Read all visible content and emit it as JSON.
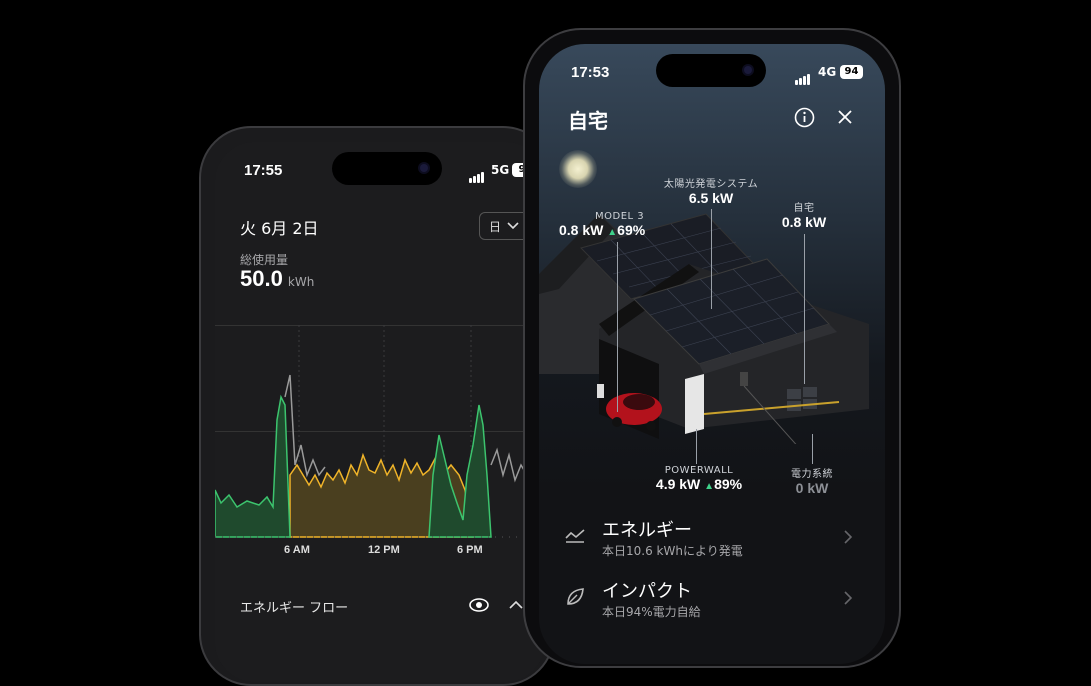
{
  "back_phone": {
    "status": {
      "time": "17:55",
      "network": "5G",
      "battery": "9"
    },
    "date_title": "火 6月 2日",
    "period_select": {
      "selected": "日",
      "chevron": "chevron-down-icon"
    },
    "usage": {
      "label": "総使用量",
      "value": "50.0",
      "unit": "kWh"
    },
    "chart_data": {
      "type": "area",
      "x_ticks": [
        "6 AM",
        "12 PM",
        "6 PM"
      ],
      "series": [
        {
          "color": "#3cc46e",
          "description": "green"
        },
        {
          "color": "#f0b429",
          "description": "yellow"
        },
        {
          "color": "#9a9a9a",
          "description": "grey"
        }
      ]
    },
    "energy_flow": {
      "label": "エネルギー フロー",
      "eye_icon": "eye-icon",
      "chevron": "chevron-up-icon"
    }
  },
  "front_phone": {
    "status": {
      "time": "17:53",
      "network": "4G",
      "battery": "94"
    },
    "title": "自宅",
    "info_icon": "info-icon",
    "close_icon": "close-icon",
    "annotations": {
      "model3": {
        "label": "MODEL 3",
        "value": "0.8 kW",
        "percent": "69%"
      },
      "solar": {
        "label": "太陽光発電システム",
        "value": "6.5 kW"
      },
      "home": {
        "label": "自宅",
        "value": "0.8 kW"
      },
      "powerwall": {
        "label": "POWERWALL",
        "value": "4.9 kW",
        "percent": "89%"
      },
      "grid": {
        "label": "電力系統",
        "value": "0 kW"
      }
    },
    "rows": [
      {
        "title": "エネルギー",
        "subtitle": "本日10.6 kWhにより発電",
        "icon": "chart-line-icon"
      },
      {
        "title": "インパクト",
        "subtitle": "本日94%電力自給",
        "icon": "leaf-icon"
      }
    ],
    "colors": {
      "accent_green": "#3fd28a"
    }
  }
}
